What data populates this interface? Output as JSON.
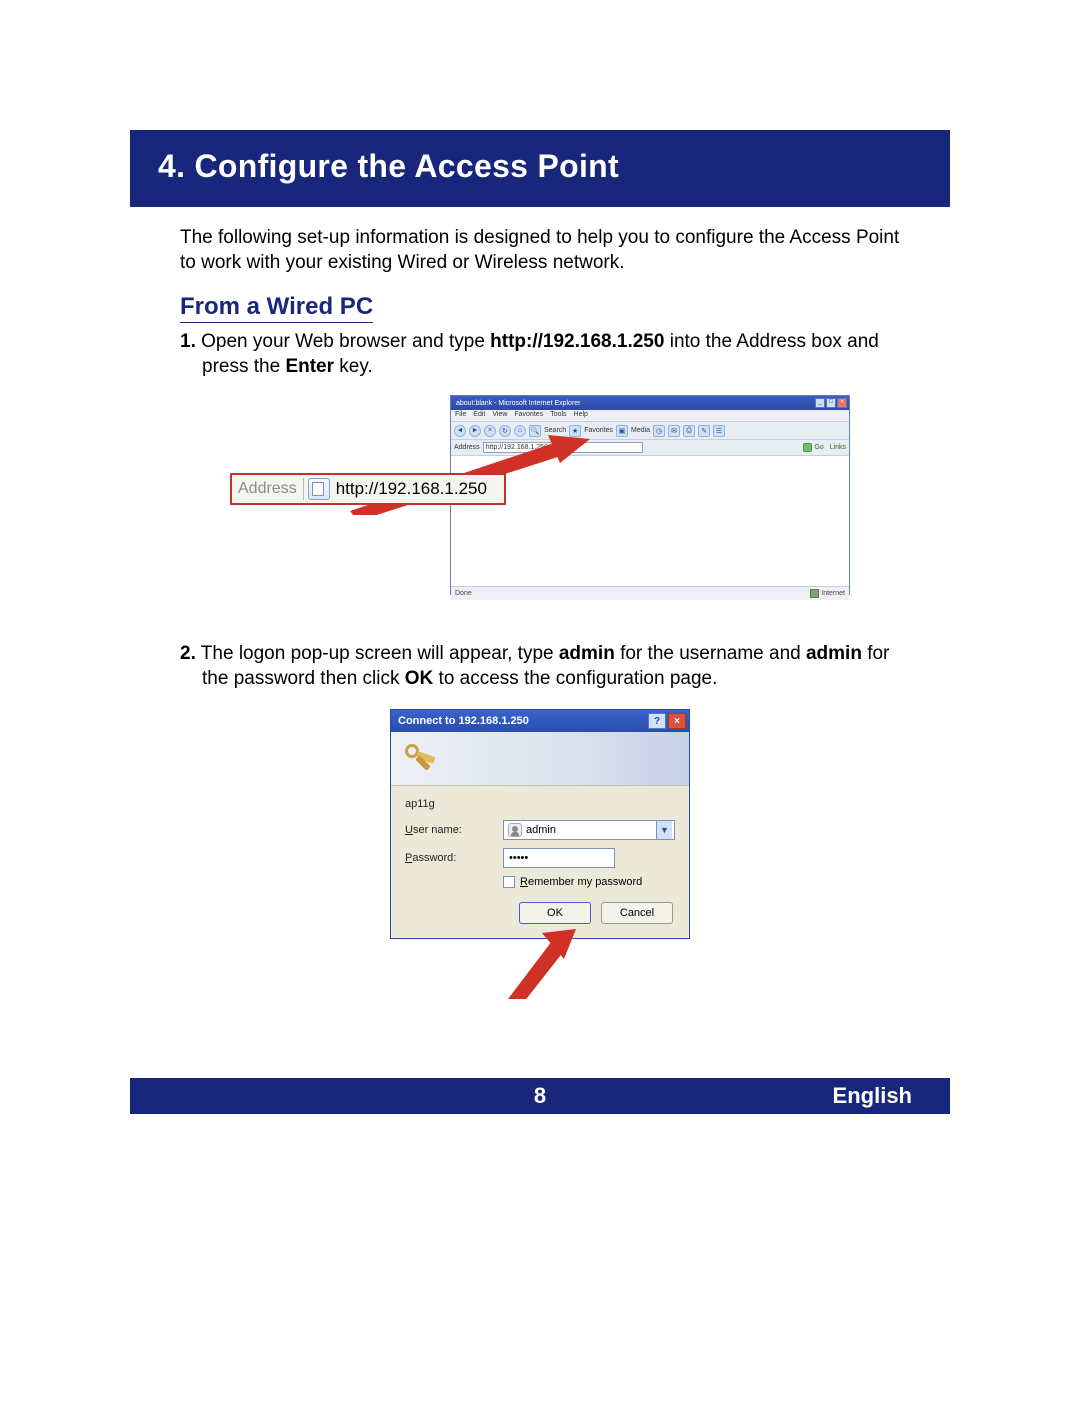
{
  "header": {
    "title": "4. Configure the Access Point"
  },
  "intro": "The following set-up information is designed to help you to configure the Access Point to work with your existing Wired or Wireless network.",
  "section": {
    "heading": "From a Wired PC"
  },
  "step1": {
    "num": "1.",
    "pre": " Open your Web browser and type ",
    "url": "http://192.168.1.250",
    "mid": " into the Address box and press the ",
    "key": "Enter",
    "post": " key."
  },
  "browser": {
    "title": "about:blank - Microsoft Internet Explorer",
    "menu": [
      "File",
      "Edit",
      "View",
      "Favorites",
      "Tools",
      "Help"
    ],
    "toolbar": {
      "search": "Search",
      "favorites": "Favorites",
      "media": "Media"
    },
    "address_label": "Address",
    "address_value": "http://192.168.1.250",
    "go": "Go",
    "links": "Links",
    "status_left": "Done",
    "status_right": "Internet"
  },
  "callout": {
    "label": "Address",
    "url": "http://192.168.1.250"
  },
  "step2": {
    "num": "2.",
    "pre": " The logon pop-up screen will appear, type ",
    "user": "admin",
    "mid1": " for the username and ",
    "pass": "admin",
    "mid2": " for the password then click ",
    "ok": "OK",
    "post": " to access the configuration page."
  },
  "dialog": {
    "title": "Connect to 192.168.1.250",
    "realm": "ap11g",
    "user_label_u": "U",
    "user_label_rest": "ser name:",
    "pass_label_u": "P",
    "pass_label_rest": "assword:",
    "user_value": "admin",
    "pass_value": "•••••",
    "remember_u": "R",
    "remember_rest": "emember my password",
    "ok": "OK",
    "cancel": "Cancel"
  },
  "footer": {
    "page": "8",
    "language": "English"
  }
}
